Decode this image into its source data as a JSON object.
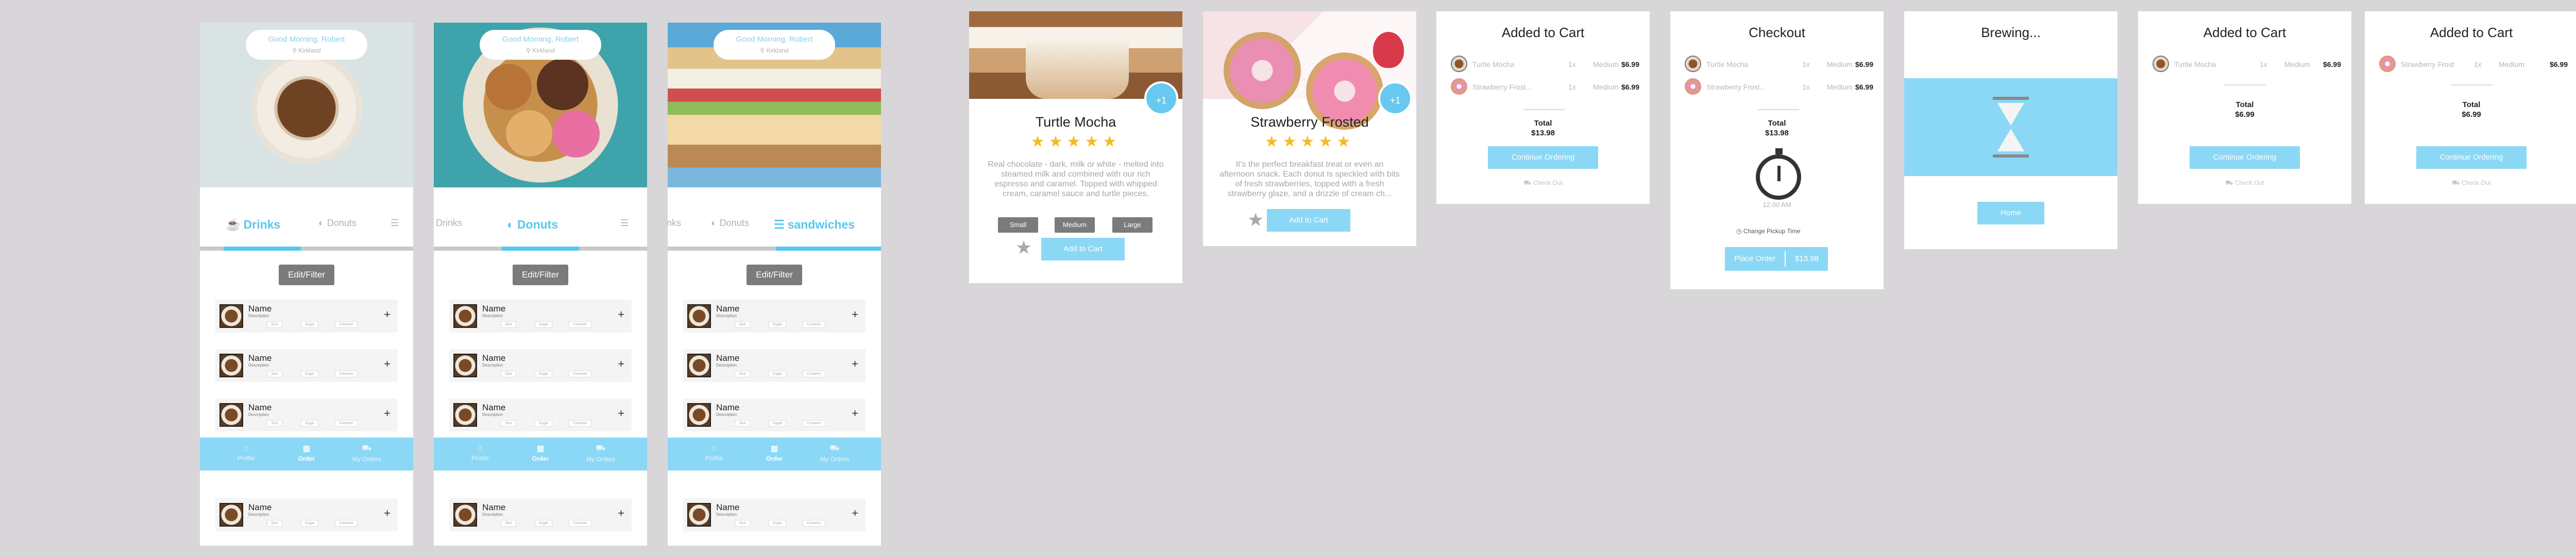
{
  "menu_screens": [
    {
      "greeting": "Good Morning, Robert",
      "location": "Kirkland",
      "categories": [
        "Drinks",
        "Donuts",
        ""
      ],
      "active_category": "Drinks",
      "edit_label": "Edit/Filter",
      "items": [
        {
          "name": "Name",
          "desc": "Description",
          "chips": [
            "Size",
            "Sugar",
            "Creamer"
          ],
          "plus": "+"
        },
        {
          "name": "Name",
          "desc": "Description",
          "chips": [
            "Size",
            "Sugar",
            "Creamer"
          ],
          "plus": "+"
        },
        {
          "name": "Name",
          "desc": "Description",
          "chips": [
            "Size",
            "Sugar",
            "Creamer"
          ],
          "plus": "+"
        },
        {
          "name": "Name",
          "desc": "Description",
          "chips": [
            "Size",
            "Sugar",
            "Creamer"
          ],
          "plus": "+"
        }
      ],
      "tabs": [
        "Profile",
        "Order",
        "My Orders"
      ]
    },
    {
      "greeting": "Good Morning, Robert",
      "location": "Kirkland",
      "categories": [
        "Drinks",
        "Donuts",
        ""
      ],
      "active_category": "Donuts",
      "edit_label": "Edit/Filter",
      "items": [
        {
          "name": "Name",
          "desc": "Description",
          "chips": [
            "Size",
            "Sugar",
            "Creamer"
          ],
          "plus": "+"
        },
        {
          "name": "Name",
          "desc": "Description",
          "chips": [
            "Size",
            "Sugar",
            "Creamer"
          ],
          "plus": "+"
        },
        {
          "name": "Name",
          "desc": "Description",
          "chips": [
            "Size",
            "Sugar",
            "Creamer"
          ],
          "plus": "+"
        },
        {
          "name": "Name",
          "desc": "Description",
          "chips": [
            "Size",
            "Sugar",
            "Creamer"
          ],
          "plus": "+"
        }
      ],
      "tabs": [
        "Profile",
        "Order",
        "My Orders"
      ]
    },
    {
      "greeting": "Good Morning, Robert",
      "location": "Kirkland",
      "categories": [
        "nks",
        "Donuts",
        "sandwiches"
      ],
      "active_category": "sandwiches",
      "edit_label": "Edit/Filter",
      "items": [
        {
          "name": "Name",
          "desc": "Description",
          "chips": [
            "Size",
            "Sugar",
            "Creamer"
          ],
          "plus": "+"
        },
        {
          "name": "Name",
          "desc": "Description",
          "chips": [
            "Size",
            "Sugar",
            "Creamer"
          ],
          "plus": "+"
        },
        {
          "name": "Name",
          "desc": "Description",
          "chips": [
            "Size",
            "Sugar",
            "Creamer"
          ],
          "plus": "+"
        },
        {
          "name": "Name",
          "desc": "Description",
          "chips": [
            "Size",
            "Sugar",
            "Creamer"
          ],
          "plus": "+"
        }
      ],
      "tabs": [
        "Profile",
        "Order",
        "My Orders"
      ]
    }
  ],
  "product_mocha": {
    "badge": "+1",
    "title": "Turtle Mocha",
    "stars": "★★★★★",
    "description": "Real chocolate - dark, milk or white - melted into steamed milk and combined with our rich espresso and caramel. Topped with whipped cream, caramel sauce and turtle pieces.",
    "sizes": [
      "Small",
      "Medium",
      "Large"
    ],
    "fav": "★",
    "add_label": "Add to Cart"
  },
  "product_strawberry": {
    "badge": "+1",
    "title": "Strawberry Frosted",
    "stars": "★★★★★",
    "description": "It's the perfect breakfast treat or even an afternoon snack. Each donut is speckled with bits of fresh strawberries, topped with a fresh strawberry glaze, and a drizzle of cream ch...",
    "fav": "★",
    "add_label": "Add to Cart"
  },
  "cart1": {
    "title": "Added to Cart",
    "items": [
      {
        "name": "Turtle Mocha",
        "qty": "1x",
        "size": "Medium",
        "price": "$6.99"
      },
      {
        "name": "Strawberry Frost...",
        "qty": "1x",
        "size": "Medium",
        "price": "$6.99"
      }
    ],
    "total_label": "Total",
    "total": "$13.98",
    "continue_label": "Continue Ordering",
    "checkout_label": "Check Out"
  },
  "checkout": {
    "title": "Checkout",
    "items": [
      {
        "name": "Turtle Mocha",
        "qty": "1x",
        "size": "Medium",
        "price": "$6.99"
      },
      {
        "name": "Strawberry Frost...",
        "qty": "1x",
        "size": "Medium",
        "price": "$6.99"
      }
    ],
    "total_label": "Total",
    "total": "$13.98",
    "pickup_time": "12:00 AM",
    "change_pickup": "Change Pickup Time",
    "place_label": "Place Order",
    "place_total": "$13.98"
  },
  "brewing": {
    "title": "Brewing...",
    "home_label": "Home"
  },
  "cart2": {
    "title": "Added to Cart",
    "items": [
      {
        "name": "Turtle Mocha",
        "qty": "1x",
        "size": "Medium",
        "price": "$6.99"
      }
    ],
    "total_label": "Total",
    "total": "$6.99",
    "continue_label": "Continue Ordering",
    "checkout_label": "Check Out"
  },
  "cart3": {
    "title": "Added to Cart",
    "items": [
      {
        "name": "Strawberry Frost",
        "qty": "1x",
        "size": "Medium",
        "price": "$6.99"
      }
    ],
    "total_label": "Total",
    "total": "$6.99",
    "continue_label": "Continue Ordering",
    "checkout_label": "Check Out"
  },
  "colors": {
    "accent": "#58c6ef",
    "accent_light": "#8ad8f5",
    "star": "#f6b921",
    "gray_button": "#7b7b7b"
  }
}
